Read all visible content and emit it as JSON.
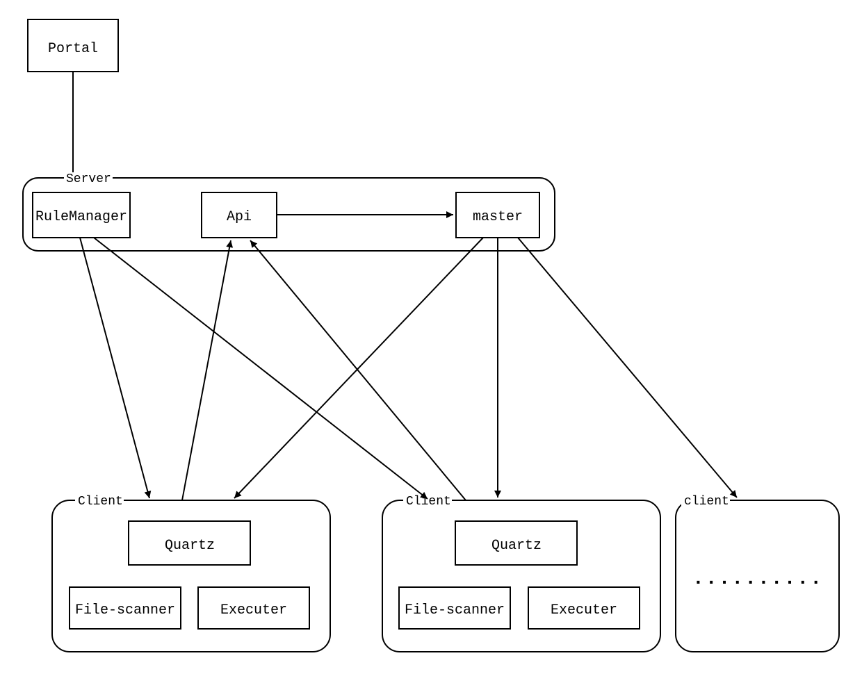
{
  "nodes": {
    "portal": {
      "label": "Portal"
    },
    "server_group": {
      "label": "Server"
    },
    "rule_manager": {
      "label": "RuleManager"
    },
    "api": {
      "label": "Api"
    },
    "master": {
      "label": "master"
    },
    "client1_group": {
      "label": "Client"
    },
    "client2_group": {
      "label": "Client"
    },
    "client3_group": {
      "label": "client"
    },
    "quartz1": {
      "label": "Quartz"
    },
    "quartz2": {
      "label": "Quartz"
    },
    "filescan1": {
      "label": "File-scanner"
    },
    "filescan2": {
      "label": "File-scanner"
    },
    "executer1": {
      "label": "Executer"
    },
    "executer2": {
      "label": "Executer"
    },
    "ellipsis": {
      "label": ".........."
    }
  },
  "edges": [
    {
      "from": "portal",
      "to": "server_group",
      "arrow": false
    },
    {
      "from": "api",
      "to": "master",
      "arrow": true
    },
    {
      "from": "rule_manager",
      "to": "client1",
      "arrow": true
    },
    {
      "from": "rule_manager",
      "to": "client2",
      "arrow": true
    },
    {
      "from": "client1",
      "to": "api",
      "arrow": true
    },
    {
      "from": "client2",
      "to": "api",
      "arrow": true
    },
    {
      "from": "master",
      "to": "client1",
      "arrow": true
    },
    {
      "from": "master",
      "to": "client2",
      "arrow": true
    },
    {
      "from": "master",
      "to": "client3",
      "arrow": true
    }
  ]
}
